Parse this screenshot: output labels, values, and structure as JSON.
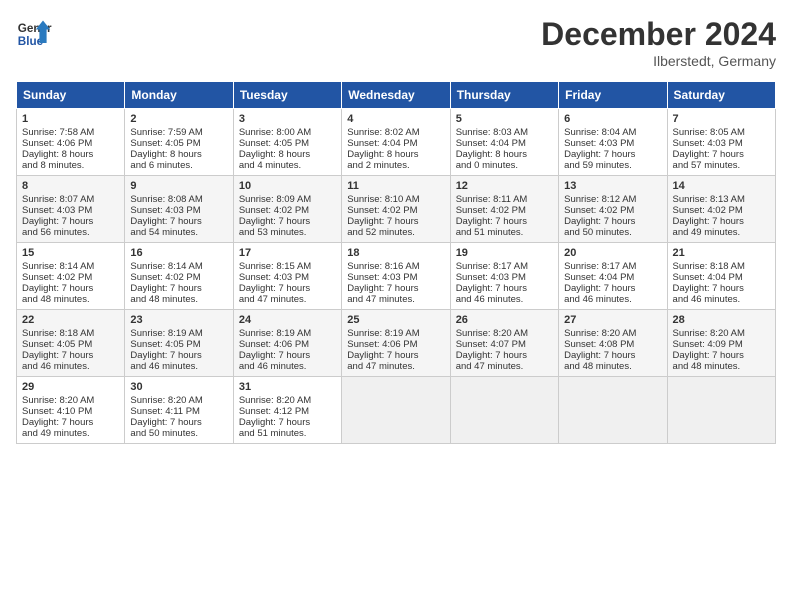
{
  "header": {
    "title": "December 2024",
    "location": "Ilberstedt, Germany",
    "logo_line1": "General",
    "logo_line2": "Blue"
  },
  "days_of_week": [
    "Sunday",
    "Monday",
    "Tuesday",
    "Wednesday",
    "Thursday",
    "Friday",
    "Saturday"
  ],
  "weeks": [
    [
      {
        "day": "1",
        "lines": [
          "Sunrise: 7:58 AM",
          "Sunset: 4:06 PM",
          "Daylight: 8 hours",
          "and 8 minutes."
        ]
      },
      {
        "day": "2",
        "lines": [
          "Sunrise: 7:59 AM",
          "Sunset: 4:05 PM",
          "Daylight: 8 hours",
          "and 6 minutes."
        ]
      },
      {
        "day": "3",
        "lines": [
          "Sunrise: 8:00 AM",
          "Sunset: 4:05 PM",
          "Daylight: 8 hours",
          "and 4 minutes."
        ]
      },
      {
        "day": "4",
        "lines": [
          "Sunrise: 8:02 AM",
          "Sunset: 4:04 PM",
          "Daylight: 8 hours",
          "and 2 minutes."
        ]
      },
      {
        "day": "5",
        "lines": [
          "Sunrise: 8:03 AM",
          "Sunset: 4:04 PM",
          "Daylight: 8 hours",
          "and 0 minutes."
        ]
      },
      {
        "day": "6",
        "lines": [
          "Sunrise: 8:04 AM",
          "Sunset: 4:03 PM",
          "Daylight: 7 hours",
          "and 59 minutes."
        ]
      },
      {
        "day": "7",
        "lines": [
          "Sunrise: 8:05 AM",
          "Sunset: 4:03 PM",
          "Daylight: 7 hours",
          "and 57 minutes."
        ]
      }
    ],
    [
      {
        "day": "8",
        "lines": [
          "Sunrise: 8:07 AM",
          "Sunset: 4:03 PM",
          "Daylight: 7 hours",
          "and 56 minutes."
        ]
      },
      {
        "day": "9",
        "lines": [
          "Sunrise: 8:08 AM",
          "Sunset: 4:03 PM",
          "Daylight: 7 hours",
          "and 54 minutes."
        ]
      },
      {
        "day": "10",
        "lines": [
          "Sunrise: 8:09 AM",
          "Sunset: 4:02 PM",
          "Daylight: 7 hours",
          "and 53 minutes."
        ]
      },
      {
        "day": "11",
        "lines": [
          "Sunrise: 8:10 AM",
          "Sunset: 4:02 PM",
          "Daylight: 7 hours",
          "and 52 minutes."
        ]
      },
      {
        "day": "12",
        "lines": [
          "Sunrise: 8:11 AM",
          "Sunset: 4:02 PM",
          "Daylight: 7 hours",
          "and 51 minutes."
        ]
      },
      {
        "day": "13",
        "lines": [
          "Sunrise: 8:12 AM",
          "Sunset: 4:02 PM",
          "Daylight: 7 hours",
          "and 50 minutes."
        ]
      },
      {
        "day": "14",
        "lines": [
          "Sunrise: 8:13 AM",
          "Sunset: 4:02 PM",
          "Daylight: 7 hours",
          "and 49 minutes."
        ]
      }
    ],
    [
      {
        "day": "15",
        "lines": [
          "Sunrise: 8:14 AM",
          "Sunset: 4:02 PM",
          "Daylight: 7 hours",
          "and 48 minutes."
        ]
      },
      {
        "day": "16",
        "lines": [
          "Sunrise: 8:14 AM",
          "Sunset: 4:02 PM",
          "Daylight: 7 hours",
          "and 48 minutes."
        ]
      },
      {
        "day": "17",
        "lines": [
          "Sunrise: 8:15 AM",
          "Sunset: 4:03 PM",
          "Daylight: 7 hours",
          "and 47 minutes."
        ]
      },
      {
        "day": "18",
        "lines": [
          "Sunrise: 8:16 AM",
          "Sunset: 4:03 PM",
          "Daylight: 7 hours",
          "and 47 minutes."
        ]
      },
      {
        "day": "19",
        "lines": [
          "Sunrise: 8:17 AM",
          "Sunset: 4:03 PM",
          "Daylight: 7 hours",
          "and 46 minutes."
        ]
      },
      {
        "day": "20",
        "lines": [
          "Sunrise: 8:17 AM",
          "Sunset: 4:04 PM",
          "Daylight: 7 hours",
          "and 46 minutes."
        ]
      },
      {
        "day": "21",
        "lines": [
          "Sunrise: 8:18 AM",
          "Sunset: 4:04 PM",
          "Daylight: 7 hours",
          "and 46 minutes."
        ]
      }
    ],
    [
      {
        "day": "22",
        "lines": [
          "Sunrise: 8:18 AM",
          "Sunset: 4:05 PM",
          "Daylight: 7 hours",
          "and 46 minutes."
        ]
      },
      {
        "day": "23",
        "lines": [
          "Sunrise: 8:19 AM",
          "Sunset: 4:05 PM",
          "Daylight: 7 hours",
          "and 46 minutes."
        ]
      },
      {
        "day": "24",
        "lines": [
          "Sunrise: 8:19 AM",
          "Sunset: 4:06 PM",
          "Daylight: 7 hours",
          "and 46 minutes."
        ]
      },
      {
        "day": "25",
        "lines": [
          "Sunrise: 8:19 AM",
          "Sunset: 4:06 PM",
          "Daylight: 7 hours",
          "and 47 minutes."
        ]
      },
      {
        "day": "26",
        "lines": [
          "Sunrise: 8:20 AM",
          "Sunset: 4:07 PM",
          "Daylight: 7 hours",
          "and 47 minutes."
        ]
      },
      {
        "day": "27",
        "lines": [
          "Sunrise: 8:20 AM",
          "Sunset: 4:08 PM",
          "Daylight: 7 hours",
          "and 48 minutes."
        ]
      },
      {
        "day": "28",
        "lines": [
          "Sunrise: 8:20 AM",
          "Sunset: 4:09 PM",
          "Daylight: 7 hours",
          "and 48 minutes."
        ]
      }
    ],
    [
      {
        "day": "29",
        "lines": [
          "Sunrise: 8:20 AM",
          "Sunset: 4:10 PM",
          "Daylight: 7 hours",
          "and 49 minutes."
        ]
      },
      {
        "day": "30",
        "lines": [
          "Sunrise: 8:20 AM",
          "Sunset: 4:11 PM",
          "Daylight: 7 hours",
          "and 50 minutes."
        ]
      },
      {
        "day": "31",
        "lines": [
          "Sunrise: 8:20 AM",
          "Sunset: 4:12 PM",
          "Daylight: 7 hours",
          "and 51 minutes."
        ]
      },
      {
        "day": "",
        "lines": []
      },
      {
        "day": "",
        "lines": []
      },
      {
        "day": "",
        "lines": []
      },
      {
        "day": "",
        "lines": []
      }
    ]
  ]
}
